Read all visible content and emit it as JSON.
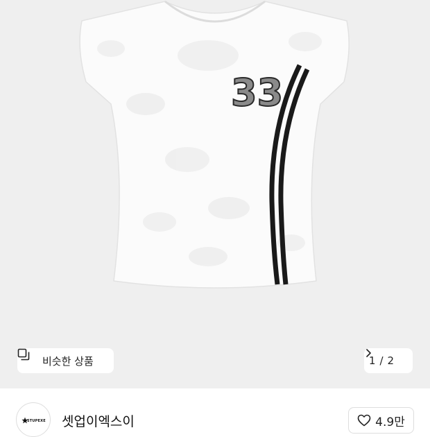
{
  "product": {
    "image_alt": "white lace t-shirt with 33 number and black stripes",
    "print_number": "33"
  },
  "similar_button": {
    "label": "비슷한 상품",
    "icon": "similar-items-icon"
  },
  "pager": {
    "current": "1",
    "separator": "/",
    "total": "2",
    "icon": "chevron-right-icon"
  },
  "seller": {
    "name": "셋업이엑스이",
    "logo_text": "STUPEXE"
  },
  "like": {
    "count": "4.9만",
    "icon": "heart-outline-icon"
  },
  "colors": {
    "image_background": "#efefef",
    "shirt": "#fafafa",
    "stripe": "#1a1a1a"
  }
}
